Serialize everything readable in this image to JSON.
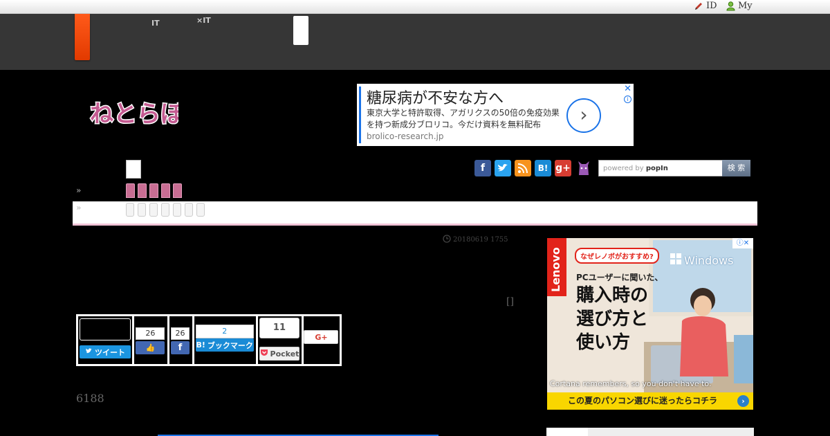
{
  "utility_bar": {
    "id_link": "ID",
    "my_link": "My"
  },
  "header": {
    "nav_1": {
      "top": "",
      "bottom": "IT"
    },
    "nav_2": {
      "top": "",
      "bottom": "×IT"
    }
  },
  "logo_text": "ねとらぼ",
  "top_ad": {
    "headline": "糖尿病が不安な方へ",
    "body": "東京大学と特許取得、アガリクスの50倍の免疫効果を持つ新成分ブロリコ。今だけ資料を無料配布",
    "domain": "brolico-research.jp",
    "close": "✕",
    "info": "i"
  },
  "social_icons": [
    "facebook-icon",
    "twitter-icon",
    "rss-icon",
    "hatena-icon",
    "google-plus-icon",
    "cat-icon"
  ],
  "site_search": {
    "powered_by": "powered by ",
    "brand": "popIn",
    "button": "検 索"
  },
  "breadcrumb": {
    "sep1": "»",
    "sep2": "»"
  },
  "article": {
    "datetime": "20180619 1755",
    "pager": "[]",
    "pageviews": "6188"
  },
  "share_bar": {
    "tweet": "ツイート",
    "fb_like_count": "26",
    "fb_share_count": "26",
    "hatena_count": "2",
    "hatena_label": "ブックマーク",
    "pocket_count": "11",
    "pocket_label": "Pocket",
    "gplus_label": "G+"
  },
  "side_ad": {
    "brand": "Lenovo",
    "bubble": "なぜレノボがおすすめ?",
    "windows": "Windows",
    "line1": "PCユーザーに聞いた、",
    "line2": "購入時の",
    "line3": "選び方と",
    "line4": "使い方",
    "caption": "Cortana remembers, so you don't have to.",
    "footer": "この夏のパソコン選びに迷ったらコチラ",
    "info": "ⓘ✕"
  }
}
